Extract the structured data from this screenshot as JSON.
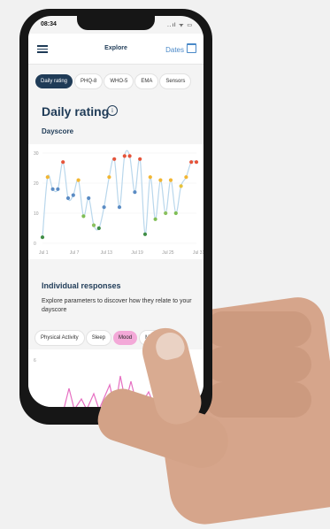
{
  "status": {
    "time": "08:34",
    "icons": "..ıl ᯤ ▭"
  },
  "header": {
    "title": "Explore",
    "dates_label": "Dates"
  },
  "tabs": [
    {
      "label": "Daily rating",
      "active": true
    },
    {
      "label": "PHQ-8"
    },
    {
      "label": "WHO-5"
    },
    {
      "label": "EMA"
    },
    {
      "label": "Sensors"
    }
  ],
  "section": {
    "title": "Daily rating",
    "info_glyph": "i",
    "subtitle": "Dayscore"
  },
  "chart_data": {
    "type": "line",
    "xlabel": "",
    "ylabel": "",
    "y_ticks": [
      "30",
      "20",
      "10",
      "0"
    ],
    "ylim": [
      0,
      30
    ],
    "x_tick_labels": [
      "Jul 1",
      "Jul 7",
      "Jul 13",
      "Jul 19",
      "Jul 25",
      "Jul 31"
    ],
    "x": [
      1,
      2,
      3,
      4,
      5,
      6,
      7,
      8,
      9,
      10,
      11,
      12,
      13,
      14,
      15,
      16,
      17,
      18,
      19,
      20,
      21,
      22,
      23,
      24,
      25,
      26,
      27,
      28,
      29,
      30,
      31
    ],
    "values": [
      2,
      22,
      18,
      18,
      27,
      15,
      16,
      21,
      9,
      15,
      6,
      5,
      12,
      22,
      28,
      12,
      29,
      29,
      17,
      28,
      3,
      22,
      8,
      21,
      10,
      21,
      10,
      19,
      22,
      27,
      27
    ],
    "point_colors": [
      "#3f8d45",
      "#f2b632",
      "#5b8cc4",
      "#5b8cc4",
      "#e5543a",
      "#5b8cc4",
      "#5b8cc4",
      "#f2b632",
      "#7fbe55",
      "#5b8cc4",
      "#8ac05e",
      "#3f8d45",
      "#5b8cc4",
      "#f2b632",
      "#e5543a",
      "#5b8cc4",
      "#e5543a",
      "#e5543a",
      "#5b8cc4",
      "#e5543a",
      "#3f8d45",
      "#f2b632",
      "#7fbe55",
      "#f2b632",
      "#8ac05e",
      "#f2b632",
      "#7fbe55",
      "#e6c23c",
      "#f2b632",
      "#e5543a",
      "#e5543a"
    ],
    "line_color": "#b9d7ec"
  },
  "responses": {
    "title": "Individual responses",
    "description": "Explore parameters to discover how they relate to your dayscore"
  },
  "chips": [
    {
      "label": "Physical Activity"
    },
    {
      "label": "Sleep"
    },
    {
      "label": "Mood",
      "active": true
    },
    {
      "label": "Medication"
    }
  ],
  "mini_chart": {
    "y_tick": "6",
    "line_color": "#e66fc2"
  }
}
